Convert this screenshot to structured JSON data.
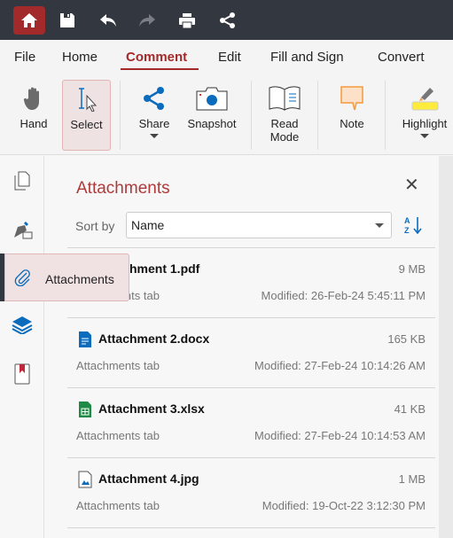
{
  "toolbar": {
    "icons": [
      "home-icon",
      "save-icon",
      "undo-icon",
      "redo-icon",
      "print-icon",
      "share-icon"
    ]
  },
  "menu": {
    "items": [
      "File",
      "Home",
      "Comment",
      "Edit",
      "Fill and Sign",
      "Convert"
    ],
    "active": "Comment"
  },
  "ribbon": {
    "hand": "Hand",
    "select": "Select",
    "share": "Share",
    "snapshot": "Snapshot",
    "read_mode_1": "Read",
    "read_mode_2": "Mode",
    "note": "Note",
    "highlight": "Highlight"
  },
  "panel": {
    "title": "Attachments",
    "sort_label": "Sort by",
    "sort_value": "Name",
    "attachments": [
      {
        "name": "Attachment 1.pdf",
        "size": "9 MB",
        "location": "Attachments tab",
        "modified": "Modified: 26-Feb-24 5:45:11 PM",
        "type": "pdf"
      },
      {
        "name": "Attachment 2.docx",
        "size": "165 KB",
        "location": "Attachments tab",
        "modified": "Modified: 27-Feb-24 10:14:26 AM",
        "type": "docx"
      },
      {
        "name": "Attachment 3.xlsx",
        "size": "41 KB",
        "location": "Attachments tab",
        "modified": "Modified: 27-Feb-24 10:14:53 AM",
        "type": "xlsx"
      },
      {
        "name": "Attachment 4.jpg",
        "size": "1 MB",
        "location": "Attachments tab",
        "modified": "Modified: 19-Oct-22 3:12:30 PM",
        "type": "jpg"
      }
    ]
  },
  "tooltip": {
    "text": "Attachments"
  },
  "colors": {
    "accent": "#a32a2a",
    "topbar": "#33373f",
    "blue": "#0b6cbd",
    "green": "#1e8a44",
    "orange": "#f39a3a"
  }
}
